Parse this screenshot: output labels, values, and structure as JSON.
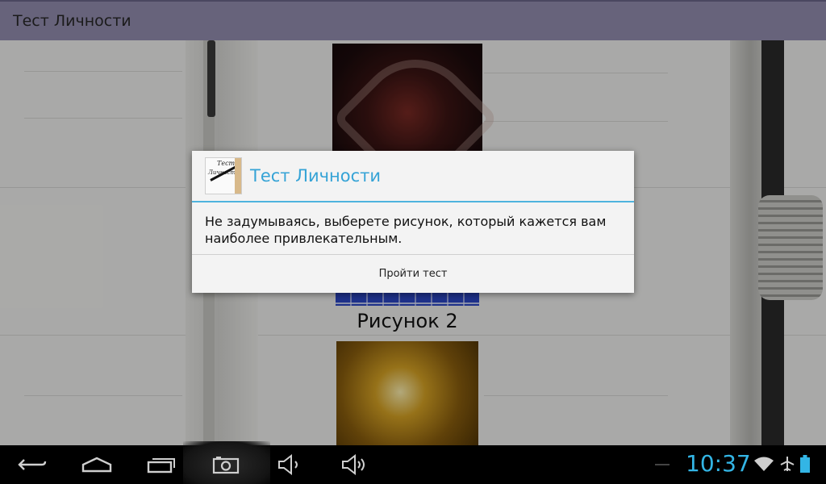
{
  "app": {
    "title": "Тест Личности"
  },
  "content": {
    "picture_label": "Рисунок 2"
  },
  "dialog": {
    "title": "Тест Личности",
    "message": "Не задумываясь, выберете рисунок, который кажется вам наиболее привлекательным.",
    "button": "Пройти тест",
    "icon_text_1": "Тест",
    "icon_text_2": "Личности"
  },
  "navbar": {
    "clock": "10:37",
    "icons": [
      "back-icon",
      "home-icon",
      "recents-icon",
      "screenshot-icon",
      "volume-down-icon",
      "volume-up-icon"
    ]
  },
  "colors": {
    "action_bar": "#67637b",
    "accent": "#35a3d6",
    "clock": "#33b5e5"
  }
}
